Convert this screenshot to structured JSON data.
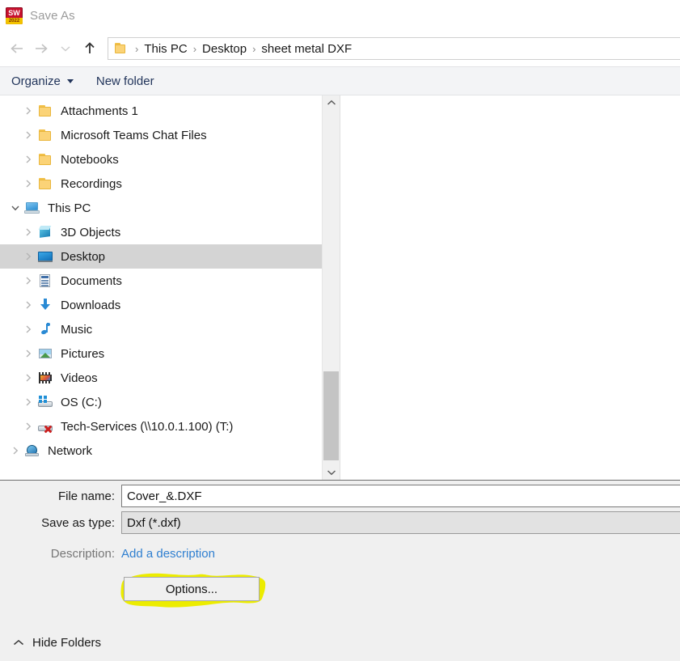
{
  "window": {
    "title": "Save As",
    "app_icon": "solidworks-icon",
    "app_icon_top_text": "SW",
    "app_icon_bottom_text": "2022"
  },
  "nav": {
    "back_icon": "back-arrow-icon",
    "forward_icon": "forward-arrow-icon",
    "recent_icon": "chevron-down-icon",
    "up_icon": "up-arrow-icon"
  },
  "breadcrumb": {
    "folder_icon": "folder-icon",
    "separator": "›",
    "items": [
      "This PC",
      "Desktop",
      "sheet metal DXF"
    ]
  },
  "toolbar": {
    "organize_label": "Organize",
    "new_folder_label": "New folder"
  },
  "tree": {
    "items": [
      {
        "label": "Attachments 1",
        "icon": "folder-icon",
        "indent": 2,
        "expandable": true,
        "expanded": false,
        "selected": false
      },
      {
        "label": "Microsoft Teams Chat Files",
        "icon": "folder-icon",
        "indent": 2,
        "expandable": true,
        "expanded": false,
        "selected": false
      },
      {
        "label": "Notebooks",
        "icon": "folder-icon",
        "indent": 2,
        "expandable": true,
        "expanded": false,
        "selected": false
      },
      {
        "label": "Recordings",
        "icon": "folder-icon",
        "indent": 2,
        "expandable": true,
        "expanded": false,
        "selected": false
      },
      {
        "label": "This PC",
        "icon": "this-pc-icon",
        "indent": 1,
        "expandable": true,
        "expanded": true,
        "selected": false
      },
      {
        "label": "3D Objects",
        "icon": "3d-objects-icon",
        "indent": 2,
        "expandable": true,
        "expanded": false,
        "selected": false
      },
      {
        "label": "Desktop",
        "icon": "desktop-icon",
        "indent": 2,
        "expandable": true,
        "expanded": false,
        "selected": true
      },
      {
        "label": "Documents",
        "icon": "documents-icon",
        "indent": 2,
        "expandable": true,
        "expanded": false,
        "selected": false
      },
      {
        "label": "Downloads",
        "icon": "downloads-icon",
        "indent": 2,
        "expandable": true,
        "expanded": false,
        "selected": false
      },
      {
        "label": "Music",
        "icon": "music-icon",
        "indent": 2,
        "expandable": true,
        "expanded": false,
        "selected": false
      },
      {
        "label": "Pictures",
        "icon": "pictures-icon",
        "indent": 2,
        "expandable": true,
        "expanded": false,
        "selected": false
      },
      {
        "label": "Videos",
        "icon": "videos-icon",
        "indent": 2,
        "expandable": true,
        "expanded": false,
        "selected": false
      },
      {
        "label": "OS (C:)",
        "icon": "drive-icon",
        "indent": 2,
        "expandable": true,
        "expanded": false,
        "selected": false
      },
      {
        "label": "Tech-Services (\\\\10.0.1.100) (T:)",
        "icon": "disconnected-network-drive-icon",
        "indent": 2,
        "expandable": true,
        "expanded": false,
        "selected": false
      },
      {
        "label": "Network",
        "icon": "network-icon",
        "indent": 1,
        "expandable": true,
        "expanded": false,
        "selected": false
      }
    ]
  },
  "scrollbar": {
    "up_icon": "chevron-up-icon",
    "down_icon": "chevron-down-icon"
  },
  "form": {
    "file_name_label": "File name:",
    "file_name_value": "Cover_&.DXF",
    "save_as_type_label": "Save as type:",
    "save_as_type_value": "Dxf (*.dxf)",
    "description_label": "Description:",
    "description_link": "Add a description",
    "options_label": "Options..."
  },
  "annotation": {
    "kind": "highlighter-marker",
    "color": "#ecec00",
    "target": "options-button"
  },
  "footer": {
    "hide_folders_label": "Hide Folders",
    "hide_folders_icon": "chevron-up-icon"
  },
  "colors": {
    "selection": "#d4d4d4",
    "link": "#2f7fd0",
    "toolbar_bg": "#f3f4f6",
    "form_bg": "#f0f0f0",
    "highlight": "#ecec00"
  }
}
